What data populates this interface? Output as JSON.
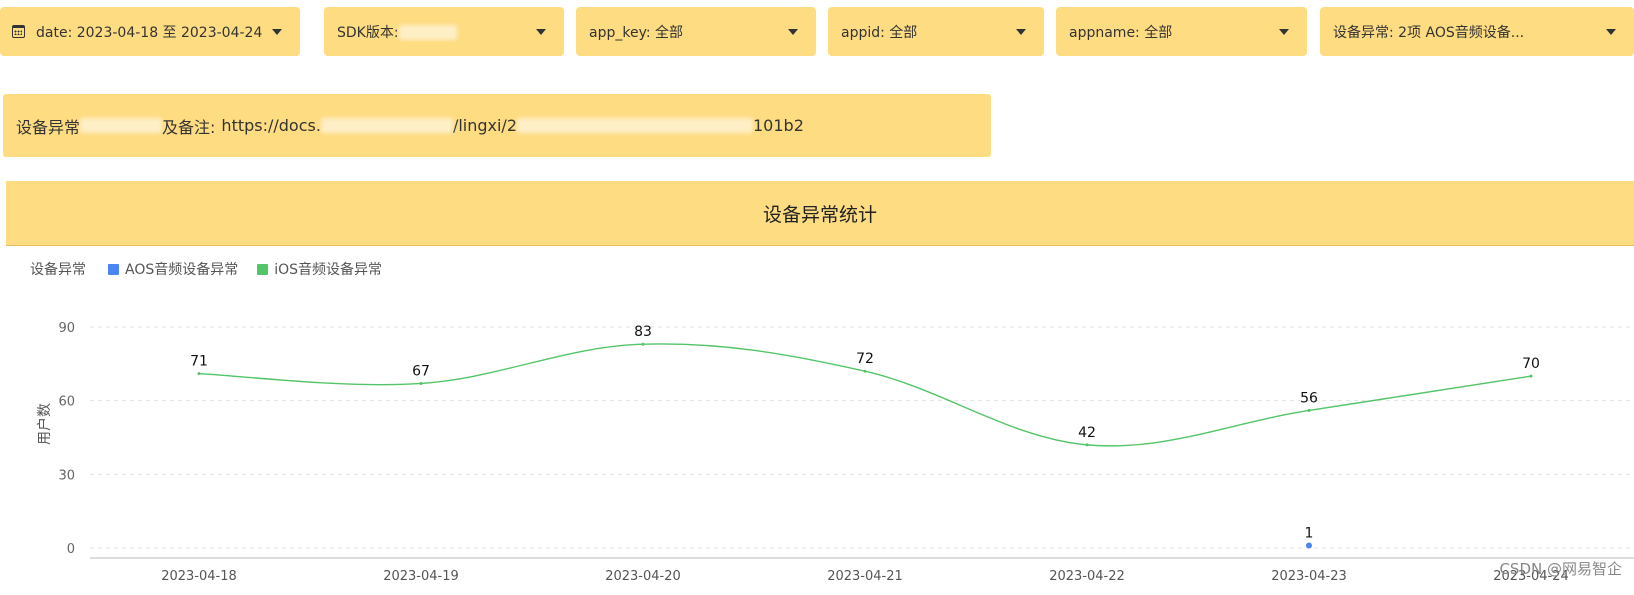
{
  "filters": {
    "date": "date: 2023-04-18 至 2023-04-24",
    "sdk": "SDK版本:",
    "app_key": "app_key: 全部",
    "appid": "appid: 全部",
    "appname": "appname: 全部",
    "device_error": "设备异常: 2项 AOS音频设备..."
  },
  "note": {
    "prefix": "设备异常",
    "middle": "及备注:",
    "url_start": "https://docs.",
    "url_mid": "/lingxi/2",
    "url_end": "101b2"
  },
  "panel": {
    "title": "设备异常统计"
  },
  "legend": {
    "title": "设备异常",
    "items": [
      {
        "label": "AOS音频设备异常",
        "color": "#4a86f2"
      },
      {
        "label": "iOS音频设备异常",
        "color": "#54c469"
      }
    ]
  },
  "chart_data": {
    "type": "line",
    "title": "设备异常统计",
    "ylabel": "用户数",
    "xlabel": "",
    "ylim": [
      0,
      90
    ],
    "yticks": [
      0,
      30,
      60,
      90
    ],
    "categories": [
      "2023-04-18",
      "2023-04-19",
      "2023-04-20",
      "2023-04-21",
      "2023-04-22",
      "2023-04-23",
      "2023-04-24"
    ],
    "series": [
      {
        "name": "AOS音频设备异常",
        "color": "#4a86f2",
        "values": [
          null,
          null,
          null,
          null,
          null,
          1,
          null
        ]
      },
      {
        "name": "iOS音频设备异常",
        "color": "#54c469",
        "values": [
          71,
          67,
          83,
          72,
          42,
          56,
          70
        ]
      }
    ],
    "grid": true
  },
  "watermark": "CSDN @网易智企"
}
